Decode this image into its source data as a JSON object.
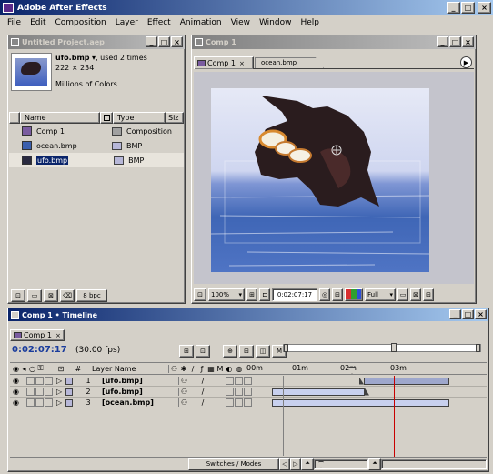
{
  "app": {
    "title": "Adobe After Effects"
  },
  "menu": [
    "File",
    "Edit",
    "Composition",
    "Layer",
    "Effect",
    "Animation",
    "View",
    "Window",
    "Help"
  ],
  "project": {
    "title": "Untitled Project.aep",
    "selected_name": "ufo.bmp",
    "used": ", used 2 times",
    "dims": "222 × 234",
    "colors": "Millions of Colors",
    "col_name": "Name",
    "col_type": "Type",
    "col_size": "Siz",
    "items": [
      {
        "name": "Comp 1",
        "type": "Composition"
      },
      {
        "name": "ocean.bmp",
        "type": "BMP"
      },
      {
        "name": "ufo.bmp",
        "type": "BMP"
      }
    ],
    "bpc": "8 bpc"
  },
  "comp": {
    "title": "Comp 1",
    "tab_active": "Comp 1",
    "tab_other": "ocean.bmp",
    "zoom": "100%",
    "timecode": "0:02:07:17",
    "quality": "Full"
  },
  "timeline": {
    "title": "Comp 1 • Timeline",
    "tab": "Comp 1",
    "timecode": "0:02:07:17",
    "fps": "(30.00 fps)",
    "col_num": "#",
    "col_layer": "Layer Name",
    "ruler": [
      "00m",
      "01m",
      "02m",
      "03m"
    ],
    "layers": [
      {
        "num": "1",
        "name": "[ufo.bmp]"
      },
      {
        "num": "2",
        "name": "[ufo.bmp]"
      },
      {
        "num": "3",
        "name": "[ocean.bmp]"
      }
    ],
    "switches_label": "Switches / Modes"
  },
  "colors": {
    "accent": "#0a246a",
    "playhead": "#c80000",
    "timecode": "#1a3c9c"
  }
}
